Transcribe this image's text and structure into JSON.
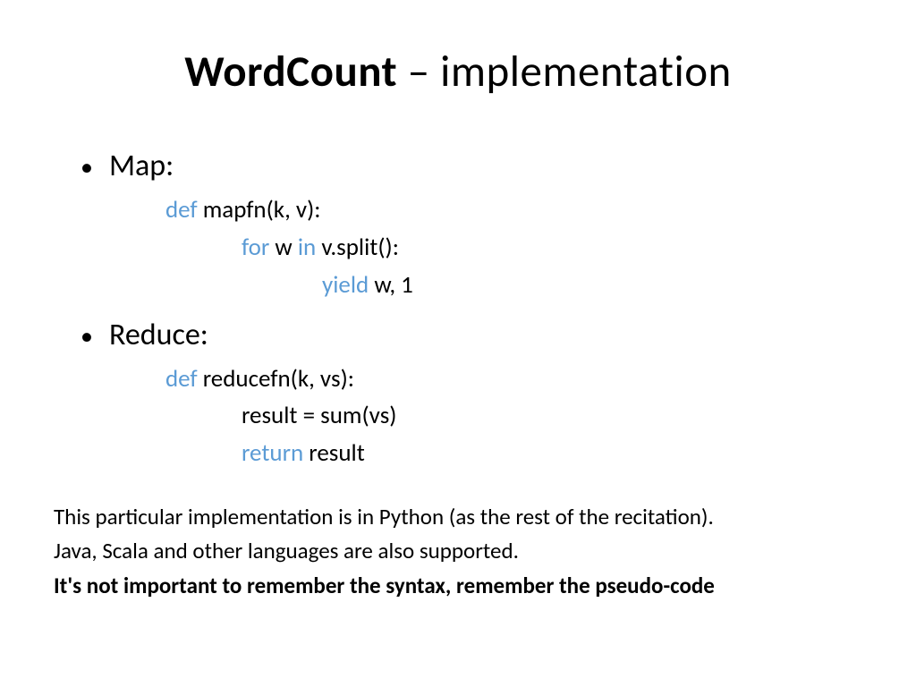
{
  "title": {
    "bold": "WordCount",
    "rest": " – implementation"
  },
  "sections": {
    "map": {
      "label": "Map:",
      "code": {
        "def": "def",
        "sig": " mapfn(k, v):",
        "for": "for",
        "in": "in",
        "loop_pre": " w ",
        "loop_post": " v.split():",
        "yield": "yield",
        "yield_post": " w, 1"
      }
    },
    "reduce": {
      "label": "Reduce:",
      "code": {
        "def": "def",
        "sig": " reducefn(k, vs):",
        "body1": "result = sum(vs)",
        "return": "return",
        "return_post": " result"
      }
    }
  },
  "footer": {
    "line1": "This particular implementation is in Python (as the rest of the recitation).",
    "line2": "Java, Scala and other languages are also supported.",
    "line3": "It's not important to remember the syntax, remember the pseudo-code"
  }
}
